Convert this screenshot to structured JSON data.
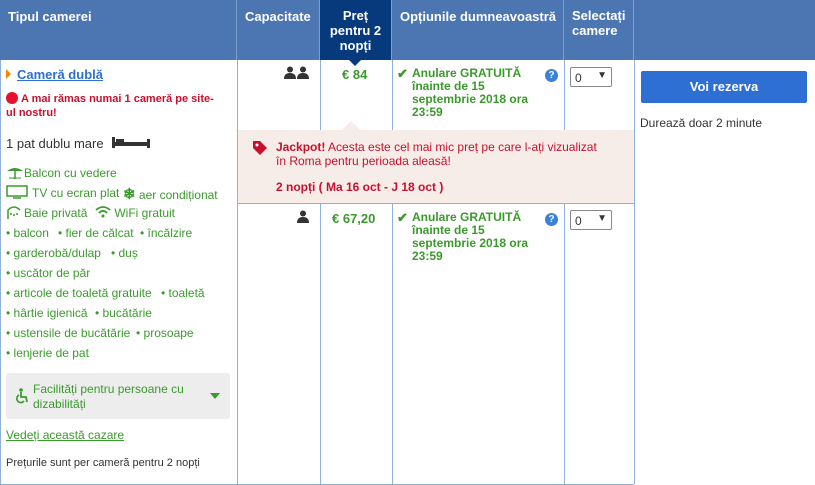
{
  "header": {
    "room_type": "Tipul camerei",
    "capacity": "Capacitate",
    "price": [
      "Preț",
      "pentru 2",
      "nopți"
    ],
    "options": "Opțiunile dumneavoastră",
    "select": [
      "Selectați",
      "camere"
    ]
  },
  "room": {
    "name": "Cameră dublă",
    "warning": [
      "A mai rămas numai 1 cameră pe site-",
      "ul nostru!"
    ],
    "bed": "1 pat dublu mare",
    "features": [
      "Balcon cu vedere",
      "TV cu ecran plat",
      "aer condiționat",
      "Baie privată",
      "WiFi gratuit"
    ],
    "amenities": [
      "balcon",
      "fier de călcat",
      "încălzire",
      "garderobă/dulap",
      "duș",
      "uscător de păr",
      "articole de toaletă gratuite",
      "toaletă",
      "hârtie igienică",
      "bucătărie",
      "ustensile de bucătărie",
      "prosoape",
      "lenjerie de pat"
    ],
    "accessibility": [
      "Facilități pentru persoane cu",
      "dizabilități"
    ],
    "view_link": "Vedeți această cazare",
    "price_note": "Prețurile sunt per cameră pentru 2 nopți"
  },
  "offers": [
    {
      "price": "€ 84",
      "cancel": [
        "Anulare GRATUITĂ",
        "înainte de 15",
        "septembrie 2018 ora",
        "23:59"
      ],
      "qty": "0"
    },
    {
      "price": "€ 67,20",
      "cancel": [
        "Anulare GRATUITĂ",
        "înainte de 15",
        "septembrie 2018 ora",
        "23:59"
      ],
      "qty": "0"
    }
  ],
  "jackpot": {
    "title": "Jackpot!",
    "text1": " Acesta este cel mai mic preț pe care l-ați vizualizat",
    "text2": "în Roma pentru perioada aleasă!",
    "dates": "2 nopți ( Ma 16 oct - J 18 oct )"
  },
  "reserve": {
    "button": "Voi rezerva",
    "note": "Durează doar 2 minute"
  },
  "colors": {
    "header": "#4b76b2",
    "header_selected": "#063a7c",
    "green": "#3a9a2c",
    "red": "#c8102e",
    "button": "#2d6fd2",
    "jackpot_bg": "#f6ece8"
  }
}
